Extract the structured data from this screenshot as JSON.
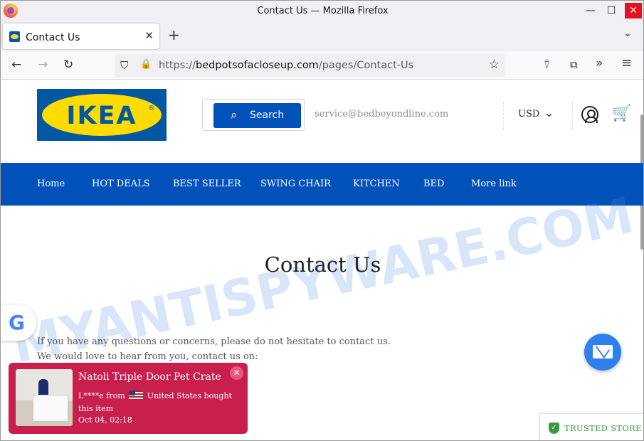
{
  "browser": {
    "window_title": "Contact Us — Mozilla Firefox",
    "minimize_glyph": "—",
    "maximize_glyph": "☐",
    "close_glyph": "✕",
    "tab_label": "Contact Us",
    "tab_close_glyph": "✕",
    "new_tab_glyph": "+",
    "tab_list_glyph": "⌄",
    "url_scheme": "https://",
    "url_domain": "bedpotsofacloseup.com",
    "url_path": "/pages/Contact-Us",
    "icons": {
      "back": "←",
      "forward": "→",
      "reload": "↻",
      "shield": "⛉",
      "lock": "🔒",
      "star": "☆",
      "pocket": "⍢",
      "extensions": "⧉",
      "overflow": "»",
      "menu": "≡"
    }
  },
  "header": {
    "logo_text": "IKEA",
    "logo_reg": "®",
    "search_label": "Search",
    "search_icon": "⌕",
    "email": "service@bedbeyondline.com",
    "currency": "USD",
    "currency_chevron": "⌄",
    "cart_icon": "🛒"
  },
  "menu": [
    "Home",
    "HOT DEALS",
    "BEST SELLER",
    "SWING CHAIR",
    "KITCHEN",
    "BED",
    "More link"
  ],
  "watermark": "MYANTISPYWARE.COM",
  "main": {
    "title": "Contact Us",
    "line1": "If you have any questions or concerns, please do not hesitate to contact us.",
    "line2": "We would love to hear from you, contact us on:"
  },
  "google_badge": "G",
  "popup": {
    "title": "Natoli Triple Door Pet Crate",
    "buyer": "L****e from",
    "location": "United States bought this item",
    "time": "Oct 04, 02:18",
    "close": "✕"
  },
  "trusted": {
    "label": "TRUSTED STORE",
    "check": "✓"
  },
  "colors": {
    "brand_blue": "#0051ba",
    "brand_yellow": "#ffdb00",
    "popup_red": "#c81f4d",
    "trusted_green": "#3a9b3e"
  }
}
